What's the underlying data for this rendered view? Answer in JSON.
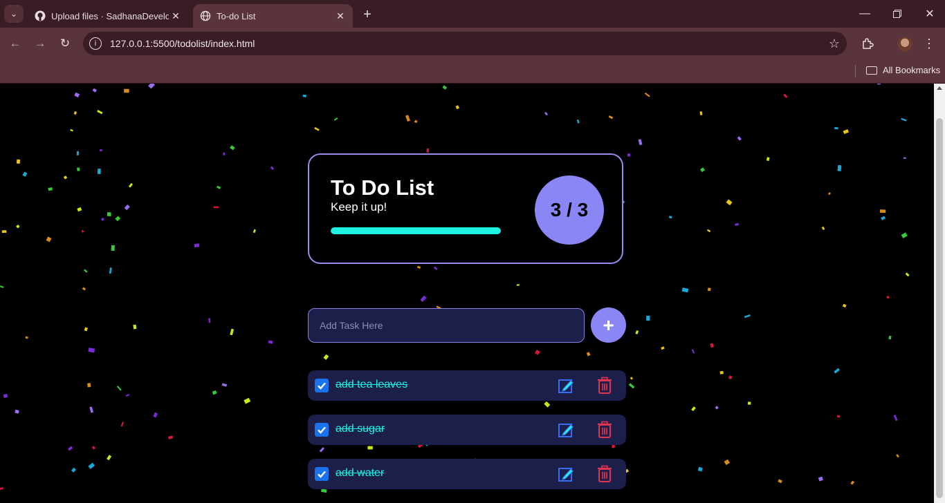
{
  "browser": {
    "tabs": [
      {
        "title": "Upload files · SadhanaDevelope",
        "icon": "github-icon",
        "active": false
      },
      {
        "title": "To-do List",
        "icon": "globe-icon",
        "active": true
      }
    ],
    "url": "127.0.0.1:5500/todolist/index.html",
    "bookmarks_label": "All Bookmarks"
  },
  "app": {
    "title": "To Do List",
    "subtitle": "Keep it up!",
    "progress_fraction": 1.0,
    "counter": "3 / 3",
    "input_placeholder": "Add Task Here",
    "add_label": "+",
    "tasks": [
      {
        "text": "add tea leaves",
        "done": true
      },
      {
        "text": "add sugar",
        "done": true
      },
      {
        "text": "add water",
        "done": true
      }
    ]
  },
  "colors": {
    "accent": "#8b86f6",
    "progress": "#1ef2e2",
    "task_bg": "#1c1f4a",
    "task_text": "#1ef2e2",
    "checkbox": "#1a73e8",
    "trash": "#e0354f",
    "chrome_dark": "#3a1c24",
    "chrome_light": "#5a343d"
  }
}
